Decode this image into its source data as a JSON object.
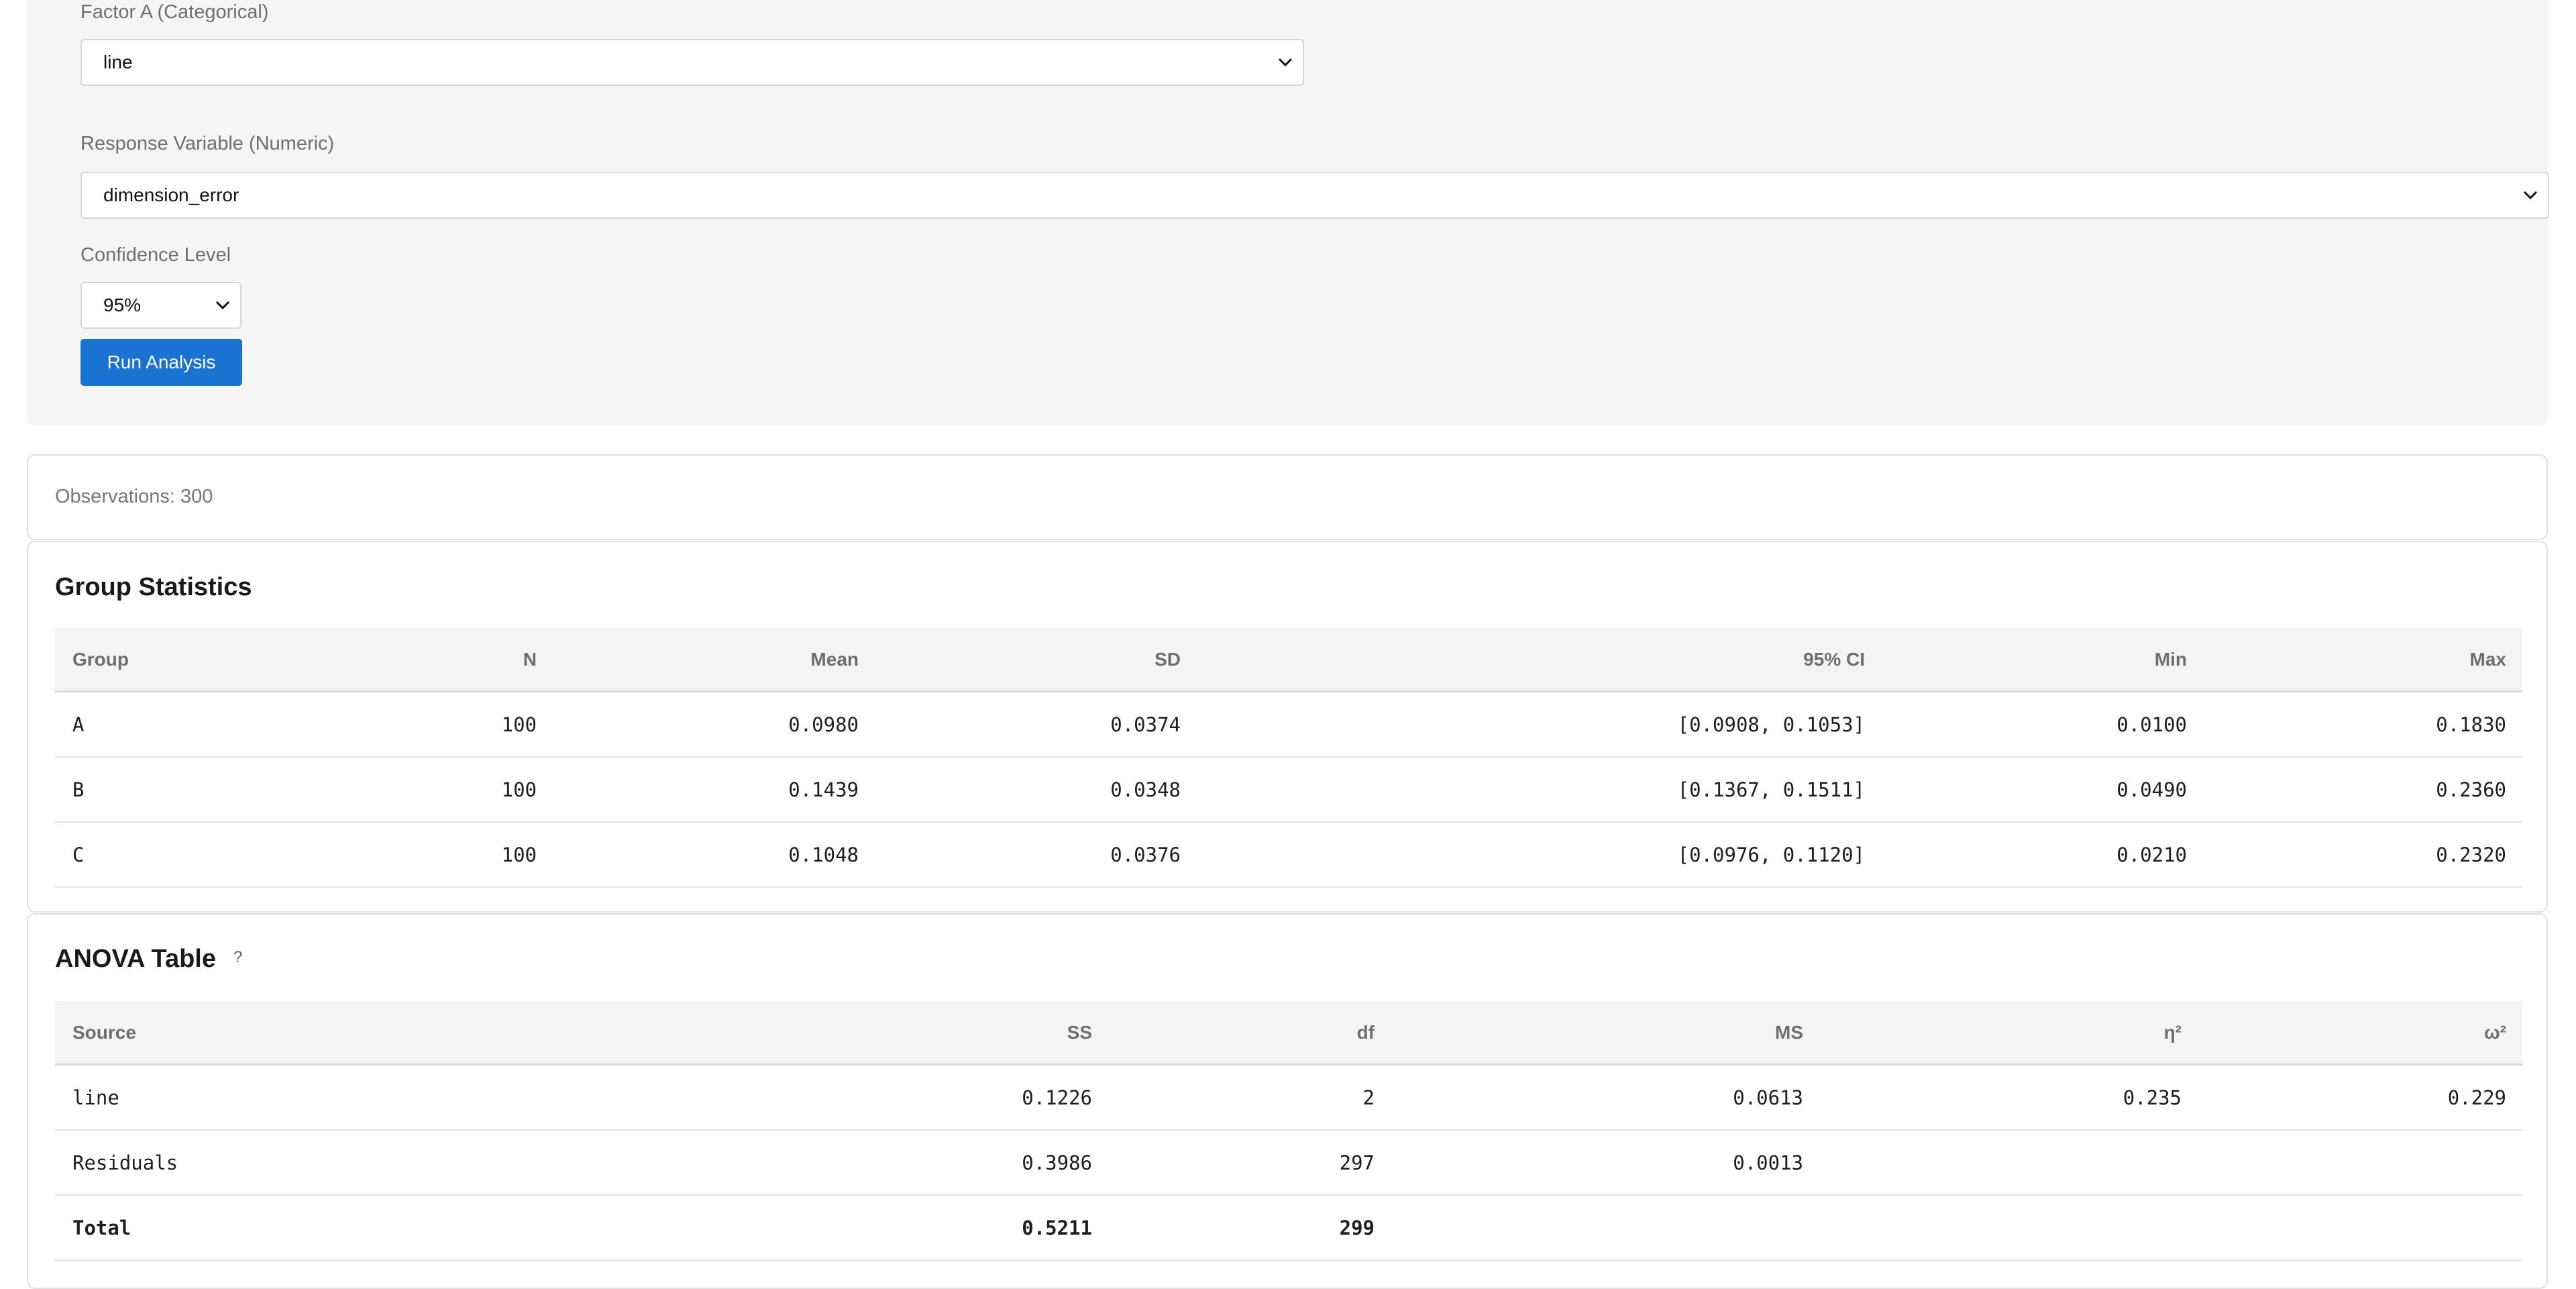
{
  "controls": {
    "factor_label": "Factor A (Categorical)",
    "factor_value": "line",
    "response_label": "Response Variable (Numeric)",
    "response_value": "dimension_error",
    "confidence_label": "Confidence Level",
    "confidence_value": "95%",
    "run_button": "Run Analysis",
    "accent_color": "#1a73d0"
  },
  "observations": {
    "text": "Observations: 300"
  },
  "group_stats": {
    "title": "Group Statistics",
    "columns": [
      "Group",
      "N",
      "Mean",
      "SD",
      "95% CI",
      "Min",
      "Max"
    ],
    "rows": [
      [
        "A",
        "100",
        "0.0980",
        "0.0374",
        "[0.0908, 0.1053]",
        "0.0100",
        "0.1830"
      ],
      [
        "B",
        "100",
        "0.1439",
        "0.0348",
        "[0.1367, 0.1511]",
        "0.0490",
        "0.2360"
      ],
      [
        "C",
        "100",
        "0.1048",
        "0.0376",
        "[0.0976, 0.1120]",
        "0.0210",
        "0.2320"
      ]
    ]
  },
  "anova": {
    "title": "ANOVA Table",
    "help": "?",
    "columns": [
      "Source",
      "SS",
      "df",
      "MS",
      "η²",
      "ω²"
    ],
    "rows": [
      [
        "line",
        "0.1226",
        "2",
        "0.0613",
        "0.235",
        "0.229"
      ],
      [
        "Residuals",
        "0.3986",
        "297",
        "0.0013",
        "",
        ""
      ],
      [
        "Total",
        "0.5211",
        "299",
        "",
        "",
        ""
      ]
    ]
  }
}
